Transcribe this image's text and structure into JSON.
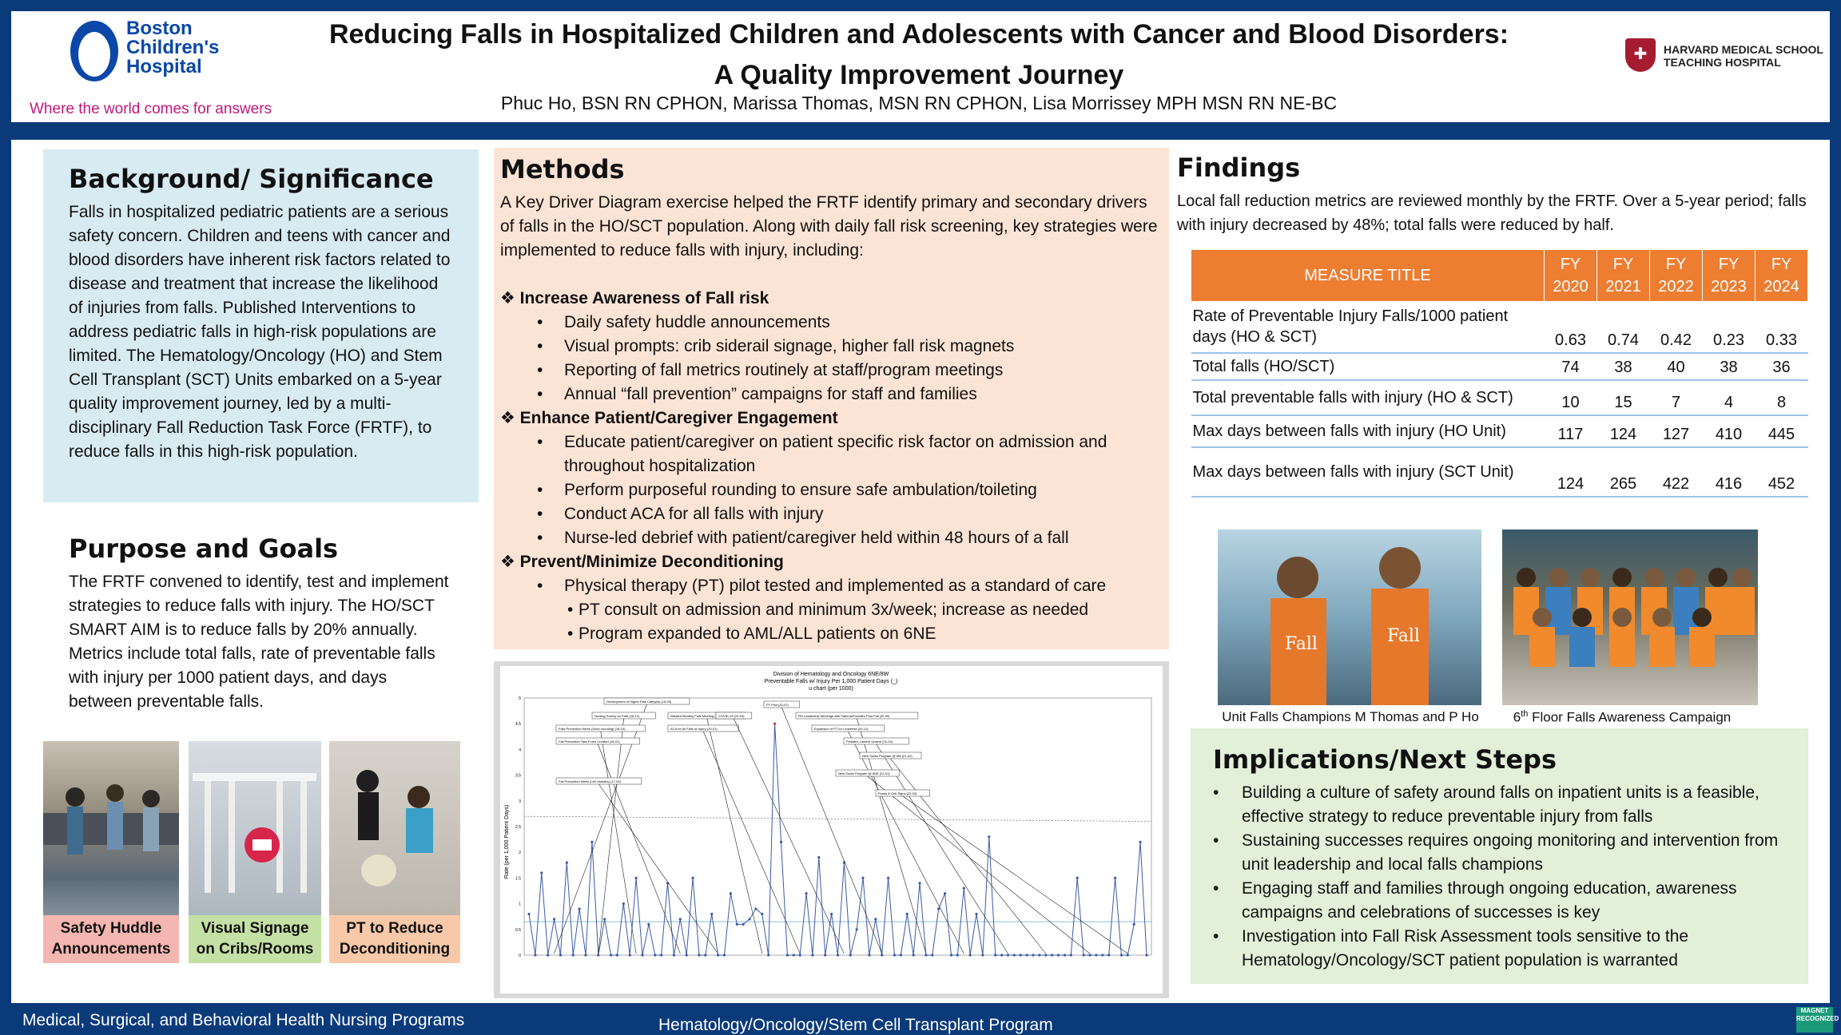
{
  "header": {
    "logo_left": "Boston Children's Hospital",
    "logo_line1": "Boston",
    "logo_line2": "Children's",
    "logo_line3": "Hospital",
    "tagline": "Where the world comes for answers",
    "title_line1": "Reducing Falls in Hospitalized Children and Adolescents with Cancer and Blood Disorders:",
    "title_line2": "A Quality Improvement Journey",
    "authors": "Phuc Ho, BSN RN CPHON,  Marissa Thomas, MSN RN CPHON, Lisa Morrissey MPH MSN RN NE-BC",
    "logo_right_line1": "HARVARD MEDICAL SCHOOL",
    "logo_right_line2": "TEACHING HOSPITAL"
  },
  "background": {
    "heading": "Background/ Significance",
    "text": "Falls in hospitalized pediatric patients are a serious safety concern. Children and teens with cancer and blood disorders have inherent risk factors related to disease and treatment that increase the likelihood of injuries from falls. Published Interventions to address pediatric falls in high-risk populations are limited. The Hematology/Oncology (HO) and Stem Cell Transplant (SCT) Units embarked on a 5-year quality improvement journey, led by a multi-disciplinary Fall Reduction Task Force (FRTF), to reduce falls in this high-risk population."
  },
  "purpose": {
    "heading": "Purpose and Goals",
    "text": "The FRTF convened to identify, test and implement strategies to reduce falls with injury. The HO/SCT SMART AIM is to reduce falls by 20% annually. Metrics include total falls, rate of preventable falls with injury per 1000 patient days, and days between preventable falls."
  },
  "photo_labels": {
    "p1_line1": "Safety Huddle",
    "p1_line2": "Announcements",
    "p2_line1": "Visual Signage",
    "p2_line2": "on Cribs/Rooms",
    "p3_line1": "PT to Reduce",
    "p3_line2": "Deconditioning"
  },
  "methods": {
    "heading": "Methods",
    "intro": "A Key Driver Diagram exercise helped the FRTF identify primary and secondary drivers of falls in the HO/SCT population. Along with daily fall risk screening, key strategies were implemented to reduce falls with injury, including:",
    "d1": "Increase Awareness of Fall risk",
    "d1_i1": "Daily safety huddle announcements",
    "d1_i2": "Visual prompts: crib siderail signage, higher fall risk magnets",
    "d1_i3": "Reporting of fall metrics routinely at staff/program meetings",
    "d1_i4": "Annual “fall prevention” campaigns for staff and families",
    "d2": "Enhance Patient/Caregiver Engagement",
    "d2_i1": "Educate patient/caregiver on patient specific risk factor on admission and throughout hospitalization",
    "d2_i2": "Perform purposeful rounding to ensure safe ambulation/toileting",
    "d2_i3": "Conduct ACA for all falls with injury",
    "d2_i4": "Nurse-led debrief with patient/caregiver held within 48 hours of a fall",
    "d3": "Prevent/Minimize Deconditioning",
    "d3_i1": "Physical therapy (PT) pilot tested and implemented as a standard of care",
    "d3_s1": "PT consult  on admission and minimum 3x/week; increase as needed",
    "d3_s2": "Program expanded to AML/ALL patients on 6NE"
  },
  "chart_header": {
    "line1": "Division of Hematology and Oncology 6NE/8W",
    "line2": "Preventable Falls w/ Injury Per 1,000 Patient Days (_)",
    "line3": "u chart (per 1000)",
    "ylabel": "Rate (per 1,000 Patient Days)"
  },
  "chart_data": {
    "type": "line",
    "title": "Division of Hematology and Oncology 6NE/8W",
    "ylabel": "Rate (per 1,000 Patient Days)",
    "ylim": [
      0,
      5
    ],
    "yticks": [
      "0",
      "0.5",
      "1",
      "1.5",
      "2",
      "2.5",
      "3",
      "3.5",
      "4",
      "4.5",
      "5"
    ],
    "values": [
      0.8,
      0,
      1.6,
      0,
      0.7,
      0,
      1.8,
      0,
      0.9,
      0,
      2.2,
      0,
      0.7,
      0,
      0,
      1.0,
      0,
      1.5,
      0,
      0.6,
      0,
      0,
      1.4,
      0,
      0.7,
      0,
      1.5,
      0,
      0,
      0.8,
      0,
      0,
      1.2,
      0.6,
      0.6,
      0.7,
      0.9,
      0.8,
      0,
      4.5,
      2.2,
      0,
      0,
      0,
      1.2,
      0,
      1.9,
      0,
      0.8,
      0,
      1.8,
      0,
      0.5,
      1.5,
      0,
      0.7,
      0,
      1.5,
      0,
      0,
      0.8,
      0,
      1.4,
      0,
      0,
      0.9,
      1.2,
      0,
      0,
      1.3,
      0,
      0.8,
      0,
      2.3,
      0,
      0,
      0,
      0,
      0,
      0,
      0,
      0,
      0,
      0,
      0,
      0,
      0,
      1.5,
      0,
      0,
      0,
      0,
      0,
      1.5,
      0,
      0,
      0.6,
      2.2,
      0
    ],
    "annotations": [
      "Development of Higher Risk Category (18-05)",
      "Nursing Survey on Falls (18-12)",
      "Falls Prevention Week (Sced rounding) (18-10)",
      "Fall Prevention Task Force Created (18-01)",
      "Fall Prevention Week (Life Huddles) (17-05)",
      "Initiated Monthly Falls Meeting (19-12)",
      "ACA for All Falls w/ Injury (20-01)",
      "COVID-19 (20-03)",
      "PT Pilot (20-07)",
      "RN Leadership Meetings with Patients/Families Post Fall (20-09)",
      "Expansion of PT for Leukemia (20-12)",
      "Pediatric Lantern Unsent (21-04)",
      "New Socks Program @ 6W (21-02)",
      "New Socks Program @ 6NE (22-01)",
      "Posey & Crib Signs (22-03)"
    ]
  },
  "findings": {
    "heading": "Findings",
    "text": "Local fall reduction metrics are reviewed monthly by the FRTF. Over a 5-year period;  falls with injury decreased by 48%; total falls were reduced by half.",
    "table_header": "MEASURE TITLE",
    "columns": [
      {
        "l1": "FY",
        "l2": "2020"
      },
      {
        "l1": "FY",
        "l2": "2021"
      },
      {
        "l1": "FY",
        "l2": "2022"
      },
      {
        "l1": "FY",
        "l2": "2023"
      },
      {
        "l1": "FY",
        "l2": "2024"
      }
    ],
    "rows": [
      {
        "measure": "Rate of Preventable Injury Falls/1000 patient days (HO & SCT)",
        "values": [
          "0.63",
          "0.74",
          "0.42",
          "0.23",
          "0.33"
        ]
      },
      {
        "measure": "Total falls (HO/SCT)",
        "values": [
          "74",
          "38",
          "40",
          "38",
          "36"
        ]
      },
      {
        "measure": "Total preventable falls with injury (HO & SCT)",
        "values": [
          "10",
          "15",
          "7",
          "4",
          "8"
        ]
      },
      {
        "measure": "Max days between falls with injury (HO Unit)",
        "values": [
          "117",
          "124",
          "127",
          "410",
          "445"
        ]
      },
      {
        "measure": "Max days between falls with injury (SCT Unit)",
        "values": [
          "124",
          "265",
          "422",
          "416",
          "452"
        ]
      }
    ],
    "caption1": "Unit Falls Champions M Thomas and P Ho",
    "caption2_sup": "th",
    "caption2_pre": "6",
    "caption2_post": " Floor Falls Awareness Campaign"
  },
  "implications": {
    "heading": "Implications/Next Steps",
    "i1": "Building a culture of safety around falls on inpatient units is a feasible, effective strategy to reduce preventable injury from falls",
    "i2": "Sustaining successes requires ongoing monitoring and intervention from unit leadership and local falls champions",
    "i3": "Engaging staff and families through ongoing education, awareness campaigns and celebrations of successes is key",
    "i4": "Investigation into Fall Risk Assessment tools sensitive to the Hematology/Oncology/SCT patient population is warranted"
  },
  "footer": {
    "left": "Medical, Surgical, and Behavioral Health Nursing Programs",
    "center": "Hematology/Oncology/Stem Cell Transplant Program",
    "badge": "MAGNET RECOGNIZED"
  }
}
